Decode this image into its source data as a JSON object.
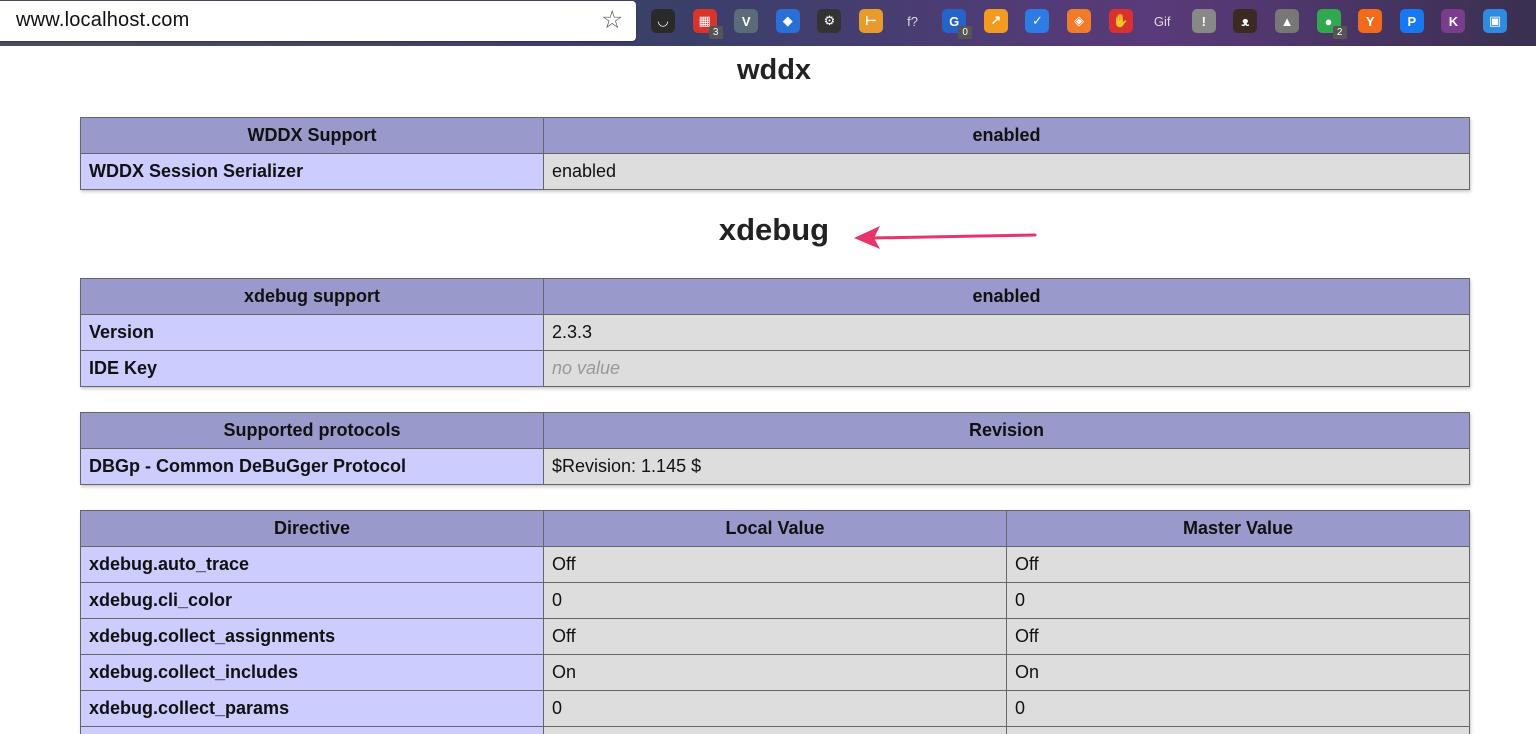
{
  "browser": {
    "url": "www.localhost.com",
    "extensions": [
      {
        "icon": "pocket-icon",
        "glyph": "◡",
        "color": "#2a2a2a"
      },
      {
        "icon": "calendar-icon",
        "glyph": "▦",
        "color": "#d9342b",
        "badge": "3"
      },
      {
        "icon": "vectr-icon",
        "glyph": "V",
        "color": "#5b6b7a"
      },
      {
        "icon": "diamond-icon",
        "glyph": "◆",
        "color": "#2a6fd6"
      },
      {
        "icon": "gear-icon",
        "glyph": "⚙",
        "color": "#333"
      },
      {
        "icon": "pin-icon",
        "glyph": "⊢",
        "color": "#e89a2a"
      },
      {
        "icon": "function-icon",
        "glyph": "f?",
        "color": "transparent"
      },
      {
        "icon": "sync-icon",
        "glyph": "G",
        "color": "#2563c9",
        "badge": "0"
      },
      {
        "icon": "chart-icon",
        "glyph": "↗",
        "color": "#f29b1f"
      },
      {
        "icon": "checkbox-icon",
        "glyph": "✓",
        "color": "#2d7be5"
      },
      {
        "icon": "layers-icon",
        "glyph": "◈",
        "color": "#f07c2a"
      },
      {
        "icon": "hand-icon",
        "glyph": "✋",
        "color": "#d93030"
      },
      {
        "icon": "gif-icon",
        "glyph": "Gif",
        "color": "transparent"
      },
      {
        "icon": "circle-icon",
        "glyph": "!",
        "color": "#888"
      },
      {
        "icon": "cat-icon",
        "glyph": "ᴥ",
        "color": "#3b2a22"
      },
      {
        "icon": "drive-icon",
        "glyph": "▲",
        "color": "#777"
      },
      {
        "icon": "chat-icon",
        "glyph": "●",
        "color": "#2fa84f",
        "badge": "2"
      },
      {
        "icon": "y-icon",
        "glyph": "Y",
        "color": "#f26a1b"
      },
      {
        "icon": "p-icon",
        "glyph": "P",
        "color": "#1877f2"
      },
      {
        "icon": "k-icon",
        "glyph": "K",
        "color": "#7a3c8c"
      },
      {
        "icon": "bookmark-icon",
        "glyph": "▣",
        "color": "#2f8be0"
      }
    ]
  },
  "wddx": {
    "title": "wddx",
    "header": [
      "WDDX Support",
      "enabled"
    ],
    "rows": [
      [
        "WDDX Session Serializer",
        "enabled"
      ]
    ]
  },
  "xdebug": {
    "title": "xdebug",
    "support_header": [
      "xdebug support",
      "enabled"
    ],
    "support_rows": [
      {
        "name": "Version",
        "value": "2.3.3",
        "novalue": false
      },
      {
        "name": "IDE Key",
        "value": "no value",
        "novalue": true
      }
    ],
    "protocols_header": [
      "Supported protocols",
      "Revision"
    ],
    "protocols_rows": [
      [
        "DBGp - Common DeBuGger Protocol",
        "$Revision: 1.145 $"
      ]
    ],
    "directives_header": [
      "Directive",
      "Local Value",
      "Master Value"
    ],
    "directives": [
      [
        "xdebug.auto_trace",
        "Off",
        "Off"
      ],
      [
        "xdebug.cli_color",
        "0",
        "0"
      ],
      [
        "xdebug.collect_assignments",
        "Off",
        "Off"
      ],
      [
        "xdebug.collect_includes",
        "On",
        "On"
      ],
      [
        "xdebug.collect_params",
        "0",
        "0"
      ],
      [
        "",
        "",
        ""
      ]
    ]
  },
  "annotation": {
    "color": "#e8336b"
  }
}
